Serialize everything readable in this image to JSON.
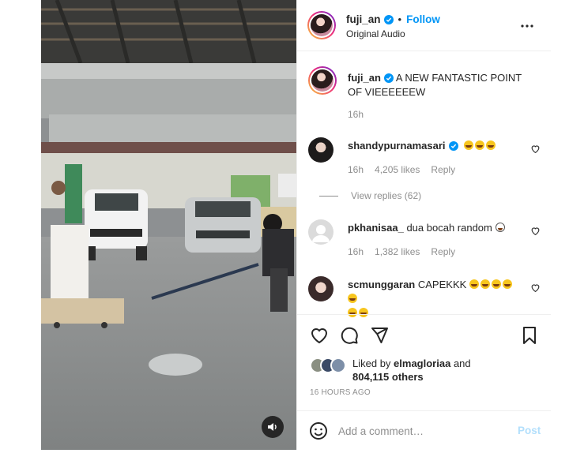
{
  "post": {
    "author": "fuji_an",
    "follow_label": "Follow",
    "separator": "•",
    "audio": "Original Audio",
    "caption": "A NEW FANTASTIC POINT OF VIEEEEEEW",
    "caption_age": "16h"
  },
  "comments": [
    {
      "user": "shandypurnamasari",
      "verified": true,
      "text": "",
      "emoji_count": 3,
      "age": "16h",
      "likes": "4,205 likes",
      "reply_label": "Reply",
      "view_replies": "View replies (62)"
    },
    {
      "user": "pkhanisaa_",
      "verified": false,
      "text": "dua bocah random",
      "emoji_count": 1,
      "age": "16h",
      "likes": "1,382 likes",
      "reply_label": "Reply"
    },
    {
      "user": "scmunggaran",
      "verified": false,
      "text": "CAPEKKK",
      "emoji_count": 7
    }
  ],
  "engagement": {
    "liked_by_prefix": "Liked by",
    "liked_by_user": "elmagloriaa",
    "and": "and",
    "others": "804,115 others",
    "timestamp": "16 HOURS AGO"
  },
  "composer": {
    "placeholder": "Add a comment…",
    "post_label": "Post"
  },
  "icons": [
    "verified-badge-icon",
    "more-options-icon",
    "heart-icon",
    "comment-icon",
    "share-icon",
    "bookmark-icon",
    "emoji-icon",
    "speaker-icon"
  ],
  "colors": {
    "follow": "#0095f6",
    "post_disabled": "#b2dffc",
    "muted_text": "#8e8e8e",
    "verified": "#0095f6"
  }
}
